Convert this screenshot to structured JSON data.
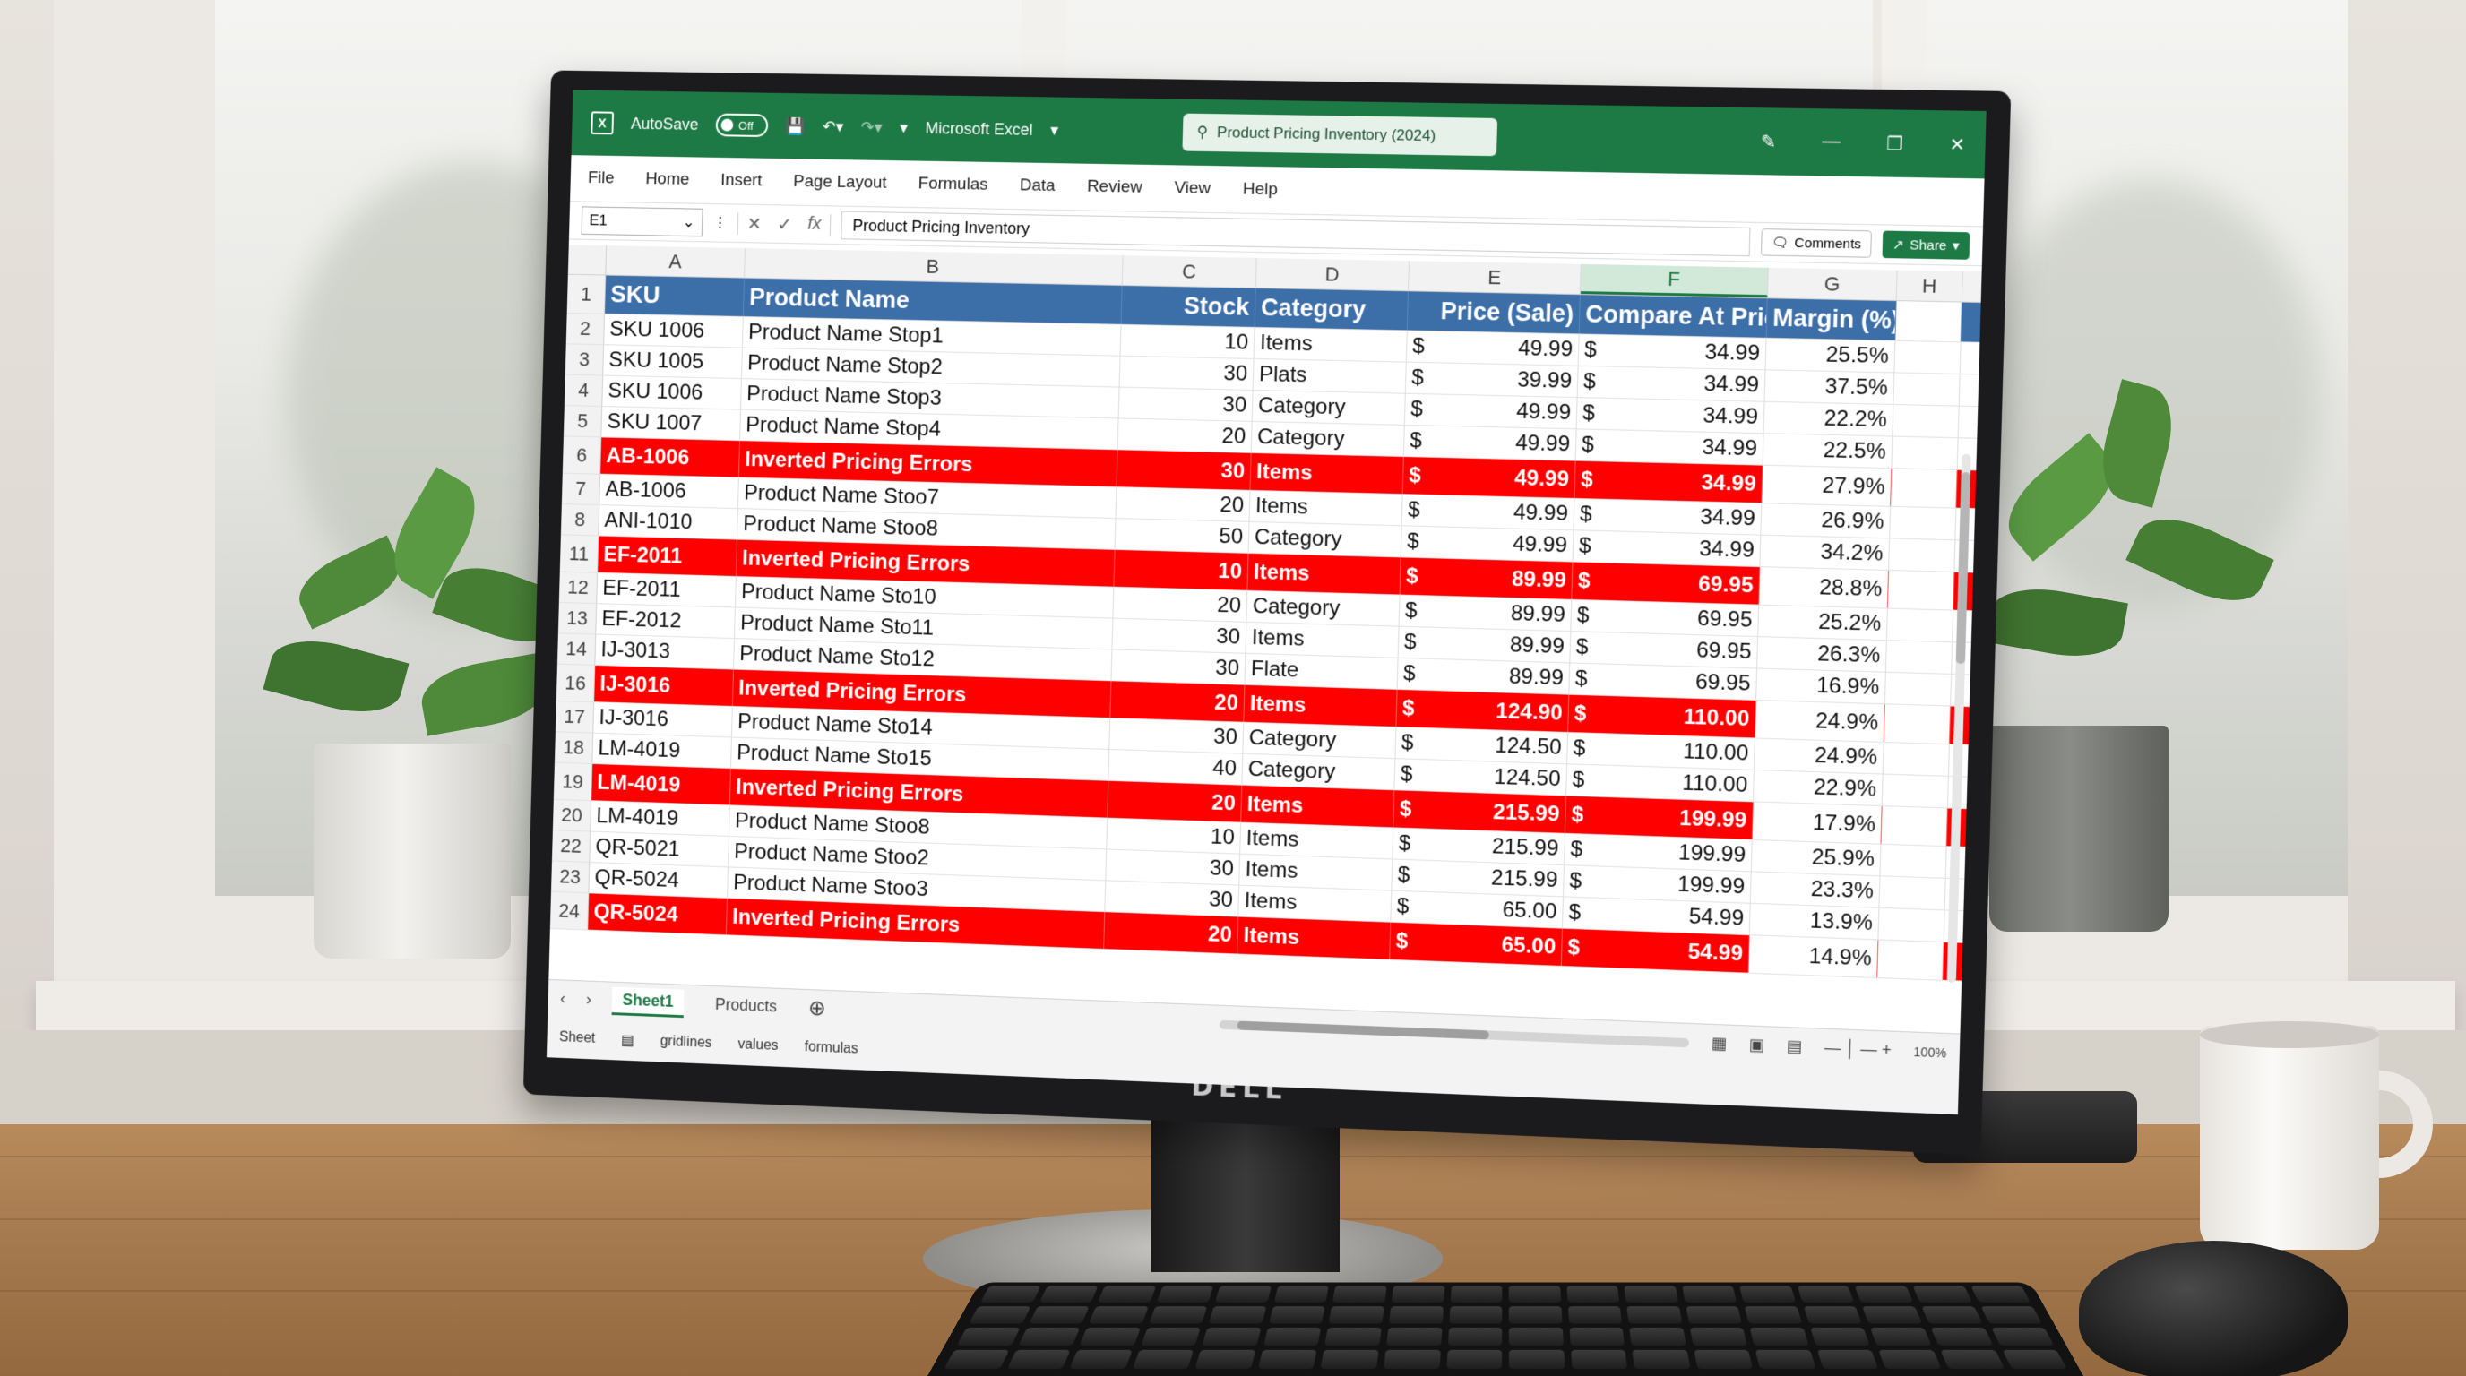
{
  "titlebar": {
    "autosave_label": "AutoSave",
    "autosave_state": "Off",
    "app_name": "Microsoft Excel",
    "search_text": "Product Pricing Inventory (2024)"
  },
  "ribbon": [
    "File",
    "Home",
    "Insert",
    "Page Layout",
    "Formulas",
    "Data",
    "Review",
    "View",
    "Help"
  ],
  "formula_bar": {
    "name_box": "E1",
    "fx_label": "fx",
    "content": "Product Pricing Inventory",
    "comments_label": "Comments",
    "share_label": "Share"
  },
  "columns": [
    "A",
    "B",
    "C",
    "D",
    "E",
    "F",
    "G",
    "H"
  ],
  "selected_column": "F",
  "header_row": {
    "row_num": "1",
    "cells": [
      "SKU",
      "Product Name",
      "Stock",
      "Category",
      "Price (Sale)",
      "Compare At Price",
      "Margin (%)",
      ""
    ]
  },
  "rows": [
    {
      "num": "2",
      "error": false,
      "sku": "SKU 1006",
      "name": "Product Name Stop1",
      "stock": "10",
      "category": "Items",
      "price": "49.99",
      "compare": "34.99",
      "margin": "25.5%"
    },
    {
      "num": "3",
      "error": false,
      "sku": "SKU 1005",
      "name": "Product Name Stop2",
      "stock": "30",
      "category": "Plats",
      "price": "39.99",
      "compare": "34.99",
      "margin": "37.5%"
    },
    {
      "num": "4",
      "error": false,
      "sku": "SKU 1006",
      "name": "Product Name Stop3",
      "stock": "30",
      "category": "Category",
      "price": "49.99",
      "compare": "34.99",
      "margin": "22.2%"
    },
    {
      "num": "5",
      "error": false,
      "sku": "SKU 1007",
      "name": "Product Name Stop4",
      "stock": "20",
      "category": "Category",
      "price": "49.99",
      "compare": "34.99",
      "margin": "22.5%"
    },
    {
      "num": "6",
      "error": true,
      "sku": "AB-1006",
      "name": "Inverted Pricing Errors",
      "stock": "30",
      "category": "Items",
      "price": "49.99",
      "compare": "34.99",
      "margin": "27.9%"
    },
    {
      "num": "7",
      "error": false,
      "sku": "AB-1006",
      "name": "Product Name Stoo7",
      "stock": "20",
      "category": "Items",
      "price": "49.99",
      "compare": "34.99",
      "margin": "26.9%"
    },
    {
      "num": "8",
      "error": false,
      "sku": "ANI-1010",
      "name": "Product Name Stoo8",
      "stock": "50",
      "category": "Category",
      "price": "49.99",
      "compare": "34.99",
      "margin": "34.2%"
    },
    {
      "num": "11",
      "error": true,
      "sku": "EF-2011",
      "name": "Inverted Pricing Errors",
      "stock": "10",
      "category": "Items",
      "price": "89.99",
      "compare": "69.95",
      "margin": "28.8%"
    },
    {
      "num": "12",
      "error": false,
      "sku": "EF-2011",
      "name": "Product Name Sto10",
      "stock": "20",
      "category": "Category",
      "price": "89.99",
      "compare": "69.95",
      "margin": "25.2%"
    },
    {
      "num": "13",
      "error": false,
      "sku": "EF-2012",
      "name": "Product Name Sto11",
      "stock": "30",
      "category": "Items",
      "price": "89.99",
      "compare": "69.95",
      "margin": "26.3%"
    },
    {
      "num": "14",
      "error": false,
      "sku": "IJ-3013",
      "name": "Product Name Sto12",
      "stock": "30",
      "category": "Flate",
      "price": "89.99",
      "compare": "69.95",
      "margin": "16.9%"
    },
    {
      "num": "16",
      "error": true,
      "sku": "IJ-3016",
      "name": "Inverted Pricing Errors",
      "stock": "20",
      "category": "Items",
      "price": "124.90",
      "compare": "110.00",
      "margin": "24.9%"
    },
    {
      "num": "17",
      "error": false,
      "sku": "IJ-3016",
      "name": "Product Name Sto14",
      "stock": "30",
      "category": "Category",
      "price": "124.50",
      "compare": "110.00",
      "margin": "24.9%"
    },
    {
      "num": "18",
      "error": false,
      "sku": "LM-4019",
      "name": "Product Name Sto15",
      "stock": "40",
      "category": "Category",
      "price": "124.50",
      "compare": "110.00",
      "margin": "22.9%"
    },
    {
      "num": "19",
      "error": true,
      "sku": "LM-4019",
      "name": "Inverted Pricing Errors",
      "stock": "20",
      "category": "Items",
      "price": "215.99",
      "compare": "199.99",
      "margin": "17.9%"
    },
    {
      "num": "20",
      "error": false,
      "sku": "LM-4019",
      "name": "Product Name Stoo8",
      "stock": "10",
      "category": "Items",
      "price": "215.99",
      "compare": "199.99",
      "margin": "25.9%"
    },
    {
      "num": "22",
      "error": false,
      "sku": "QR-5021",
      "name": "Product Name Stoo2",
      "stock": "30",
      "category": "Items",
      "price": "215.99",
      "compare": "199.99",
      "margin": "23.3%"
    },
    {
      "num": "23",
      "error": false,
      "sku": "QR-5024",
      "name": "Product Name Stoo3",
      "stock": "30",
      "category": "Items",
      "price": "65.00",
      "compare": "54.99",
      "margin": "13.9%"
    },
    {
      "num": "24",
      "error": true,
      "sku": "QR-5024",
      "name": "Inverted Pricing Errors",
      "stock": "20",
      "category": "Items",
      "price": "65.00",
      "compare": "54.99",
      "margin": "14.9%"
    }
  ],
  "currency_symbol": "$",
  "sheet_tabs": [
    "Sheet1",
    "Products"
  ],
  "active_sheet": "Sheet1",
  "zoom": "100%",
  "statusbar": [
    "Sheet",
    "gridlines",
    "values",
    "formulas"
  ],
  "monitor_brand": "DELL",
  "colors": {
    "excel_green": "#1d7a45",
    "header_blue": "#3c6ea8",
    "error_red": "#ff0000"
  }
}
